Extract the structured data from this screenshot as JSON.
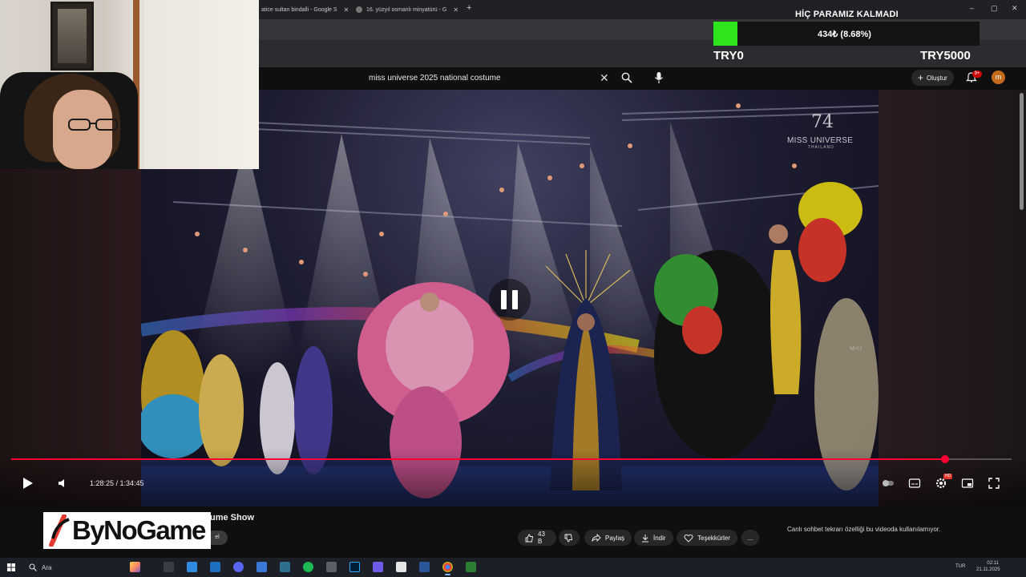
{
  "browser": {
    "tabs": [
      {
        "title": "aticе sultan bindalli - Google S"
      },
      {
        "title": "16. yüzyıl osmanlı minyatürü - G"
      }
    ]
  },
  "youtube": {
    "search_query": "miss universe 2025 national costume",
    "create_label": "Oluştur",
    "notification_count": "9+",
    "avatar_letter": "m"
  },
  "video": {
    "watermark_number": "74",
    "watermark_text": "MISS UNIVERSE",
    "watermark_sub": "THAILAND",
    "corner_mark": "M+U",
    "timecode": "1:28:25 / 1:34:45",
    "progress_fraction": 0.9333,
    "hd_badge": "HD"
  },
  "below_video": {
    "title_fragment": "ume Show",
    "subscribe_fragment": "el",
    "like_count": "43 B",
    "share_label": "Paylaş",
    "download_label": "İndir",
    "thanks_label": "Teşekkürler",
    "more_label": "...",
    "chat_note": "Canlı sohbet tekrarı özelliği bu videoda kullanılamıyor."
  },
  "donation_overlay": {
    "title": "HİÇ PARAMIZ KALMADI",
    "progress_text": "434₺ (8.68%)",
    "progress_fraction": 0.0868,
    "min_label": "TRY0",
    "max_label": "TRY5000",
    "fill_color": "#2ee51c"
  },
  "logo": {
    "text": "ByNoGame"
  },
  "taskbar": {
    "search_placeholder": "Ara",
    "language": "TUR",
    "time": "02:11",
    "date": "21.11.2025"
  },
  "colors": {
    "youtube_red": "#ff0033",
    "notification_red": "#cc0000"
  }
}
